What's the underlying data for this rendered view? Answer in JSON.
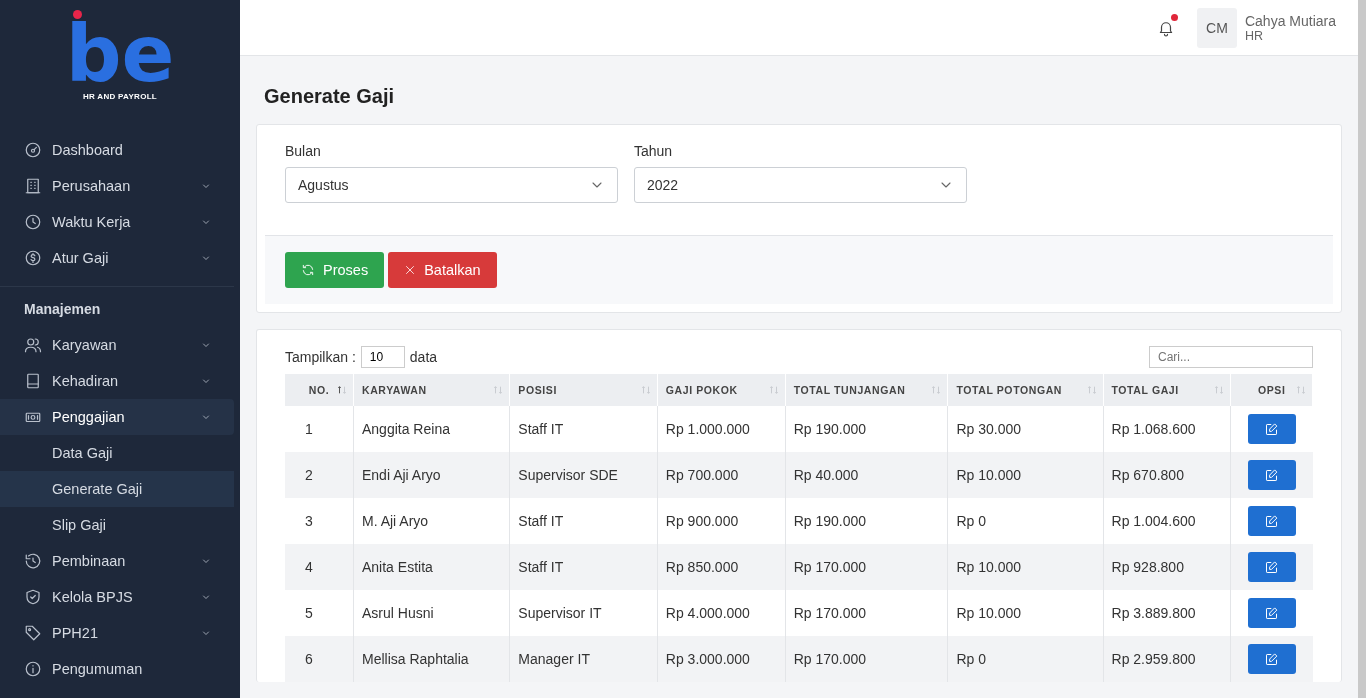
{
  "brand": {
    "logo": "be",
    "tagline": "HR AND PAYROLL"
  },
  "sidebar": {
    "items": [
      {
        "kind": "item",
        "label": "Dashboard",
        "has_submenu": false,
        "expanded": false,
        "selected": false
      },
      {
        "kind": "item",
        "label": "Perusahaan",
        "has_submenu": true,
        "expanded": false,
        "selected": false
      },
      {
        "kind": "item",
        "label": "Waktu Kerja",
        "has_submenu": true,
        "expanded": false,
        "selected": false
      },
      {
        "kind": "item",
        "label": "Atur Gaji",
        "has_submenu": true,
        "expanded": false,
        "selected": false
      },
      {
        "kind": "section",
        "label": "Manajemen"
      },
      {
        "kind": "item",
        "label": "Karyawan",
        "has_submenu": true,
        "expanded": false,
        "selected": false
      },
      {
        "kind": "item",
        "label": "Kehadiran",
        "has_submenu": true,
        "expanded": false,
        "selected": false
      },
      {
        "kind": "item",
        "label": "Penggajian",
        "has_submenu": true,
        "expanded": true,
        "selected": false,
        "children": [
          {
            "label": "Data Gaji",
            "selected": false
          },
          {
            "label": "Generate Gaji",
            "selected": true
          },
          {
            "label": "Slip Gaji",
            "selected": false
          }
        ]
      },
      {
        "kind": "item",
        "label": "Pembinaan",
        "has_submenu": true,
        "expanded": false,
        "selected": false
      },
      {
        "kind": "item",
        "label": "Kelola BPJS",
        "has_submenu": true,
        "expanded": false,
        "selected": false
      },
      {
        "kind": "item",
        "label": "PPH21",
        "has_submenu": true,
        "expanded": false,
        "selected": false
      },
      {
        "kind": "item",
        "label": "Pengumuman",
        "has_submenu": false,
        "expanded": false,
        "selected": false
      }
    ]
  },
  "topbar": {
    "notification": true,
    "user": {
      "initials": "CM",
      "name": "Cahya Mutiara",
      "role": "HR"
    }
  },
  "page_title": "Generate Gaji",
  "filters": [
    {
      "label": "Bulan",
      "value": "Agustus"
    },
    {
      "label": "Tahun",
      "value": "2022"
    }
  ],
  "actions": [
    {
      "kind": "process",
      "label": "Proses"
    },
    {
      "kind": "cancel",
      "label": "Batalkan"
    }
  ],
  "table": {
    "show_label": "Tampilkan :",
    "page_size": "10",
    "show_suffix": "data",
    "search_placeholder": "Cari...",
    "columns": [
      {
        "label": "NO.",
        "sorted": true
      },
      {
        "label": "KARYAWAN",
        "sorted": false
      },
      {
        "label": "POSISI",
        "sorted": false
      },
      {
        "label": "GAJI POKOK",
        "sorted": false
      },
      {
        "label": "TOTAL TUNJANGAN",
        "sorted": false
      },
      {
        "label": "TOTAL POTONGAN",
        "sorted": false
      },
      {
        "label": "TOTAL GAJI",
        "sorted": false
      },
      {
        "label": "OPSI",
        "sorted": false
      }
    ],
    "rows": [
      [
        "1",
        "Anggita Reina",
        "Staff IT",
        "Rp 1.000.000",
        "Rp 190.000",
        "Rp 30.000",
        "Rp 1.068.600"
      ],
      [
        "2",
        "Endi Aji Aryo",
        "Supervisor SDE",
        "Rp 700.000",
        "Rp 40.000",
        "Rp 10.000",
        "Rp 670.800"
      ],
      [
        "3",
        "M. Aji Aryo",
        "Staff IT",
        "Rp 900.000",
        "Rp 190.000",
        "Rp 0",
        "Rp 1.004.600"
      ],
      [
        "4",
        "Anita Estita",
        "Staff IT",
        "Rp 850.000",
        "Rp 170.000",
        "Rp 10.000",
        "Rp 928.800"
      ],
      [
        "5",
        "Asrul Husni",
        "Supervisor IT",
        "Rp 4.000.000",
        "Rp 170.000",
        "Rp 10.000",
        "Rp 3.889.800"
      ],
      [
        "6",
        "Mellisa Raphtalia",
        "Manager IT",
        "Rp 3.000.000",
        "Rp 170.000",
        "Rp 0",
        "Rp 2.959.800"
      ]
    ]
  }
}
